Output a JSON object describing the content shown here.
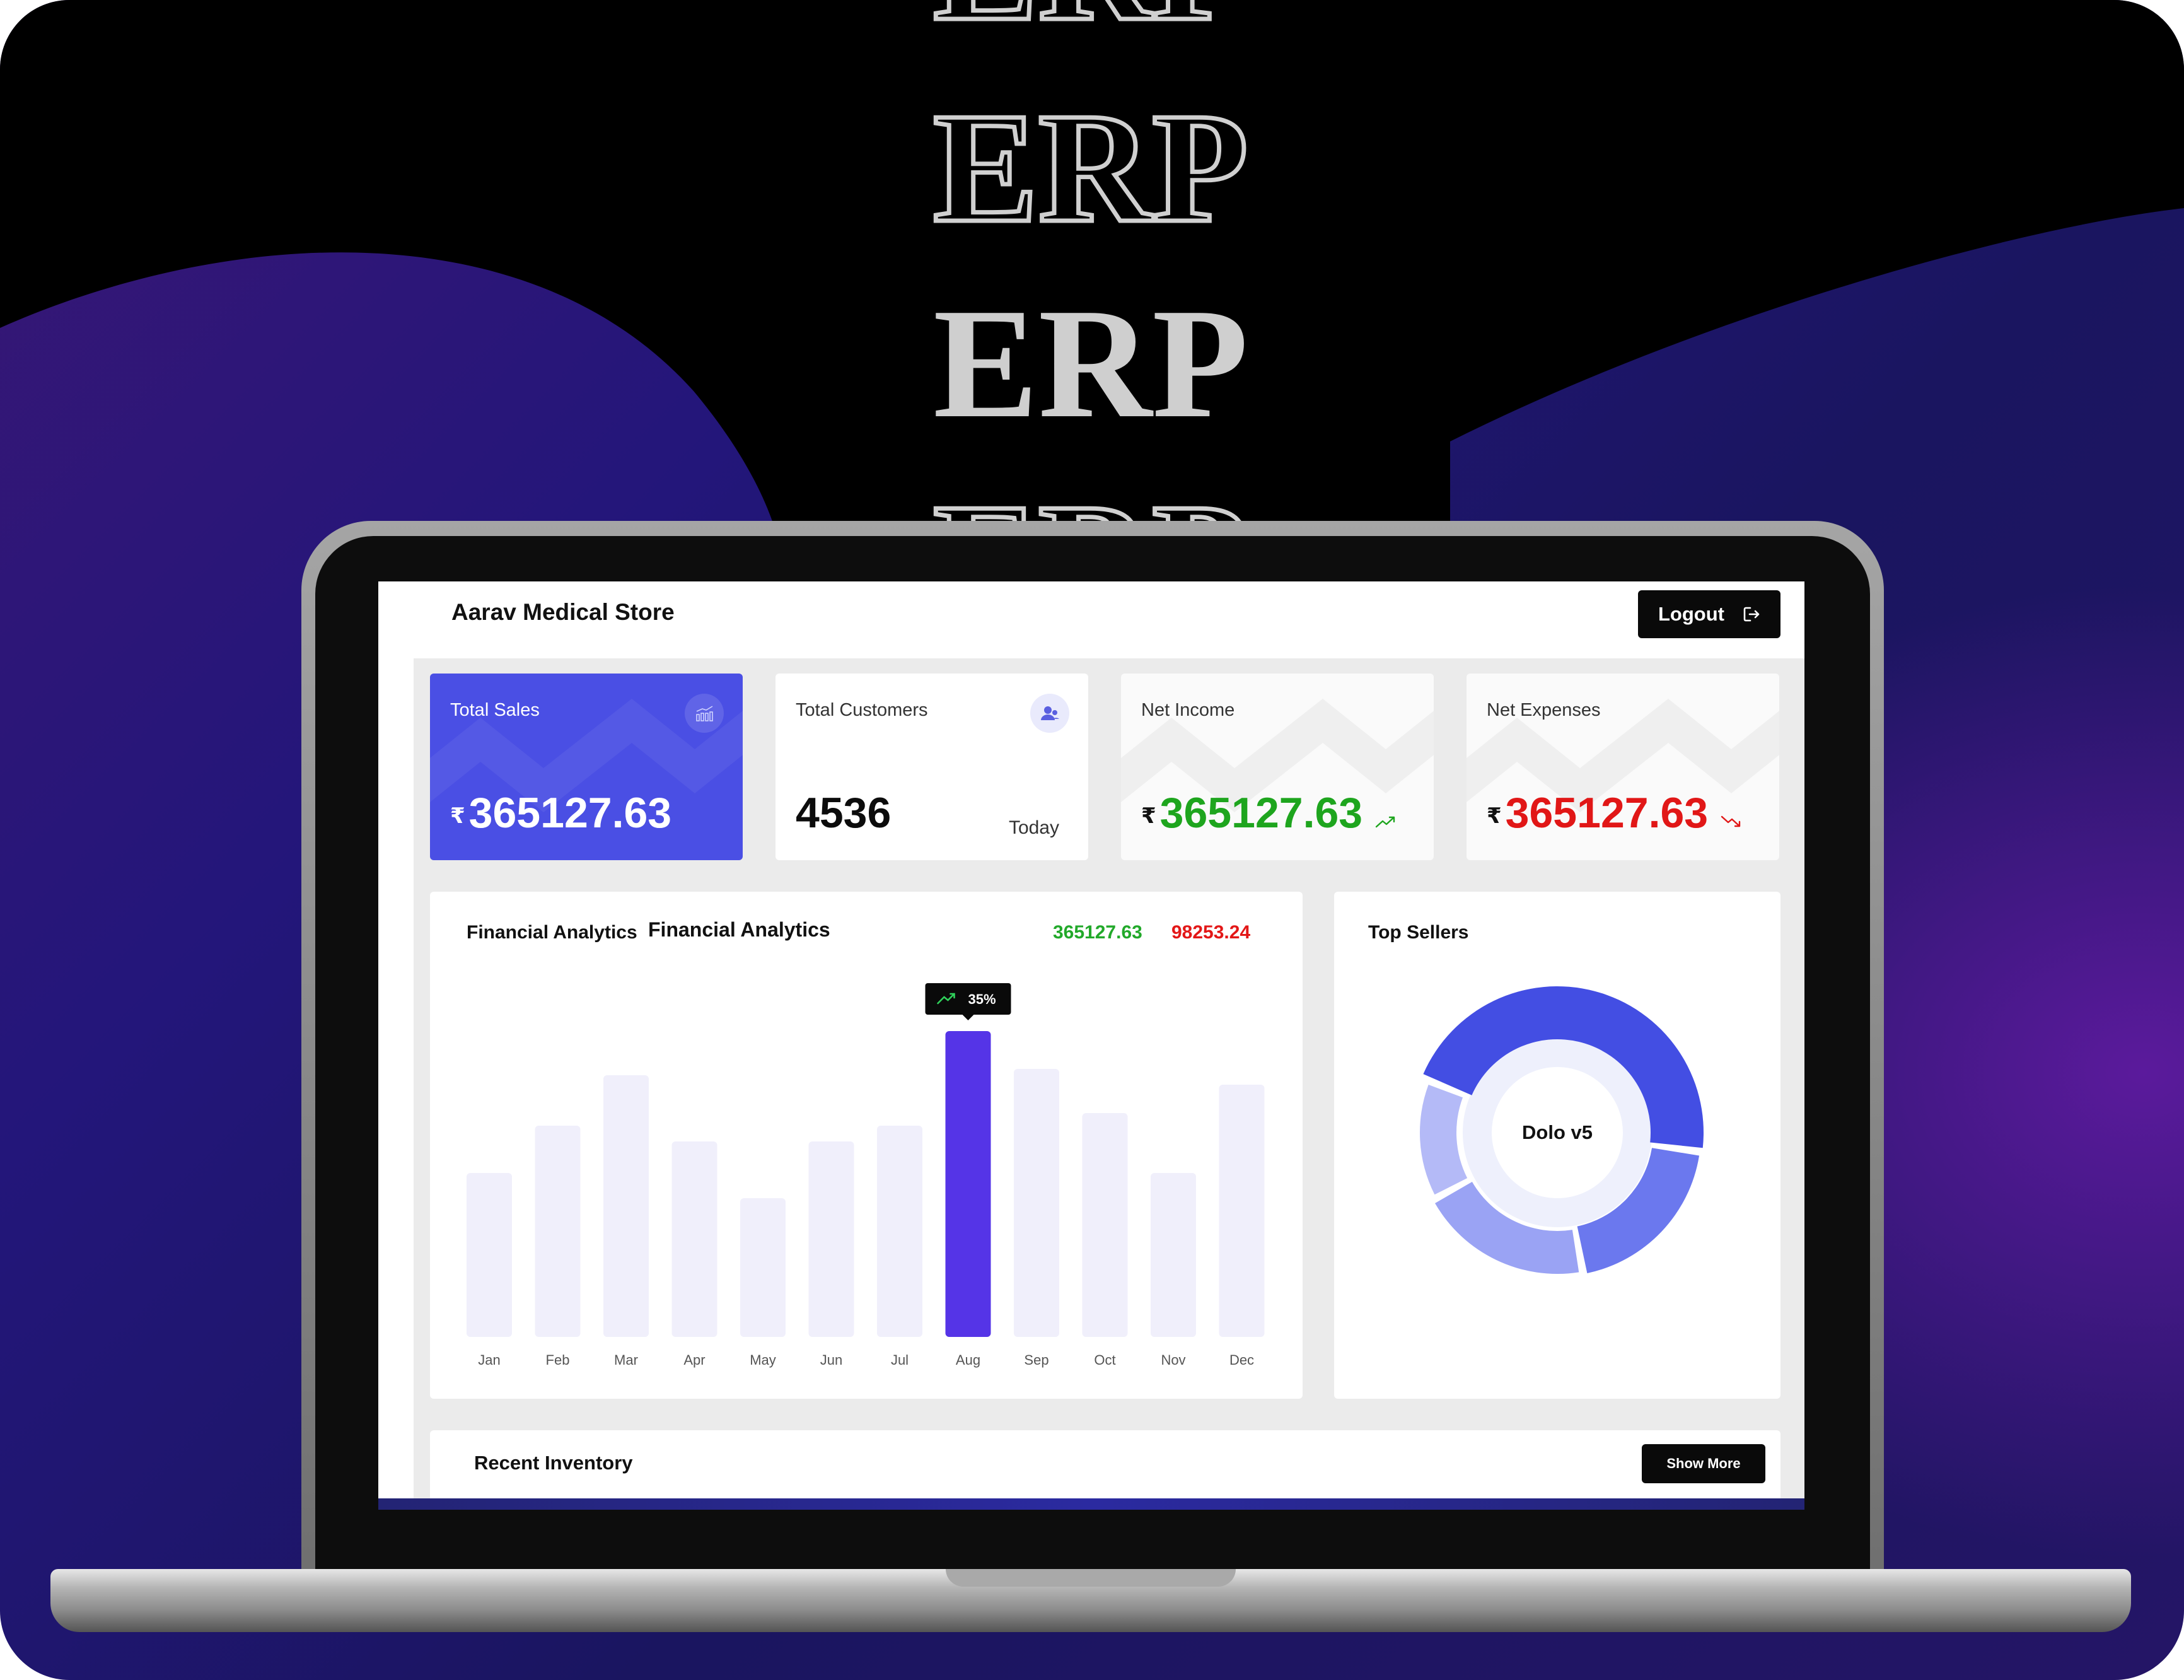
{
  "showcase": {
    "brand_words": [
      "ERP",
      "ERP",
      "ERP",
      "ERP"
    ]
  },
  "header": {
    "store_name": "Aarav Medical Store",
    "logout_label": "Logout",
    "logout_icon": "logout-icon"
  },
  "stats": {
    "currency_symbol": "₹",
    "total_sales": {
      "label": "Total Sales",
      "value": "365127.63",
      "icon": "bar-chart-icon"
    },
    "total_customers": {
      "label": "Total Customers",
      "value": "4536",
      "period": "Today",
      "icon": "users-icon"
    },
    "net_income": {
      "label": "Net Income",
      "value": "365127.63",
      "trend_icon": "trend-up-icon",
      "color": "#1ea51e"
    },
    "net_expenses": {
      "label": "Net Expenses",
      "value": "365127.63",
      "trend_icon": "trend-down-icon",
      "color": "#e11717"
    }
  },
  "analytics": {
    "title_left": "Financial Analytics",
    "title_right": "Financial Analytics",
    "income_total": "365127.63",
    "expense_total": "98253.24",
    "income_color": "#22a92a",
    "expense_color": "#e31717",
    "tooltip": "35%",
    "tooltip_icon": "trend-up-icon"
  },
  "chart_data": {
    "type": "bar",
    "categories": [
      "Jan",
      "Feb",
      "Mar",
      "Apr",
      "May",
      "Jun",
      "Jul",
      "Aug",
      "Sep",
      "Oct",
      "Nov",
      "Dec"
    ],
    "values": [
      52,
      67,
      83,
      62,
      44,
      62,
      67,
      97,
      85,
      71,
      52,
      80
    ],
    "highlight_index": 7,
    "highlight_label": "35%",
    "title": "",
    "xlabel": "",
    "ylabel": "",
    "ylim": [
      0,
      100
    ],
    "grid": false,
    "bar_color": "#f0effb",
    "highlight_color": "#5534e7"
  },
  "top_sellers": {
    "title": "Top Sellers",
    "center_label": "Dolo v5",
    "segments": [
      {
        "share": 46,
        "color": "#434ee3"
      },
      {
        "share": 20,
        "color": "#6b78ee"
      },
      {
        "share": 20,
        "color": "#9aa3f4"
      },
      {
        "share": 14,
        "color": "#b4baf7"
      }
    ]
  },
  "inventory": {
    "title": "Recent Inventory",
    "show_more_label": "Show More"
  }
}
